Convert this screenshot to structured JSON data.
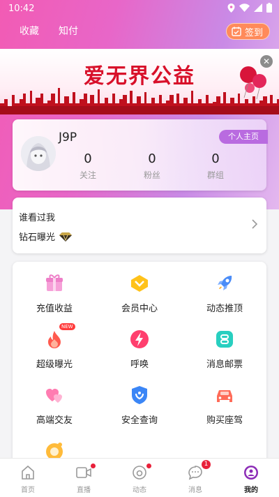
{
  "status_bar": {
    "time": "10:42"
  },
  "top_nav": {
    "collect": "收藏",
    "zhifu": "知付",
    "sign_in": "签到"
  },
  "banner": {
    "title": "爱无界公益"
  },
  "profile": {
    "username": "J9P",
    "home_button": "个人主页",
    "stats": [
      {
        "value": "0",
        "label": "关注"
      },
      {
        "value": "0",
        "label": "粉丝"
      },
      {
        "value": "0",
        "label": "群组"
      }
    ]
  },
  "visitors": {
    "title": "谁看过我",
    "diamond": "钻石曝光"
  },
  "services": [
    {
      "label": "充值收益",
      "icon": "gift-icon"
    },
    {
      "label": "会员中心",
      "icon": "vip-icon"
    },
    {
      "label": "动态推顶",
      "icon": "rocket-icon"
    },
    {
      "label": "超级曝光",
      "icon": "flame-icon",
      "badge": "NEW"
    },
    {
      "label": "呼唤",
      "icon": "lightning-icon"
    },
    {
      "label": "消息邮票",
      "icon": "stamp-icon"
    },
    {
      "label": "高端交友",
      "icon": "hearts-icon"
    },
    {
      "label": "安全查询",
      "icon": "shield-icon"
    },
    {
      "label": "购买座驾",
      "icon": "car-icon"
    }
  ],
  "tabs": [
    {
      "label": "首页",
      "icon": "home-icon"
    },
    {
      "label": "直播",
      "icon": "video-icon"
    },
    {
      "label": "动态",
      "icon": "moments-icon"
    },
    {
      "label": "消息",
      "icon": "message-icon",
      "count": "1"
    },
    {
      "label": "我的",
      "icon": "profile-icon"
    }
  ],
  "colors": {
    "accent": "#b96be0",
    "brand_pink": "#f25bb4",
    "sign_orange": "#ff8a5a",
    "badge_red": "#e8203a"
  }
}
